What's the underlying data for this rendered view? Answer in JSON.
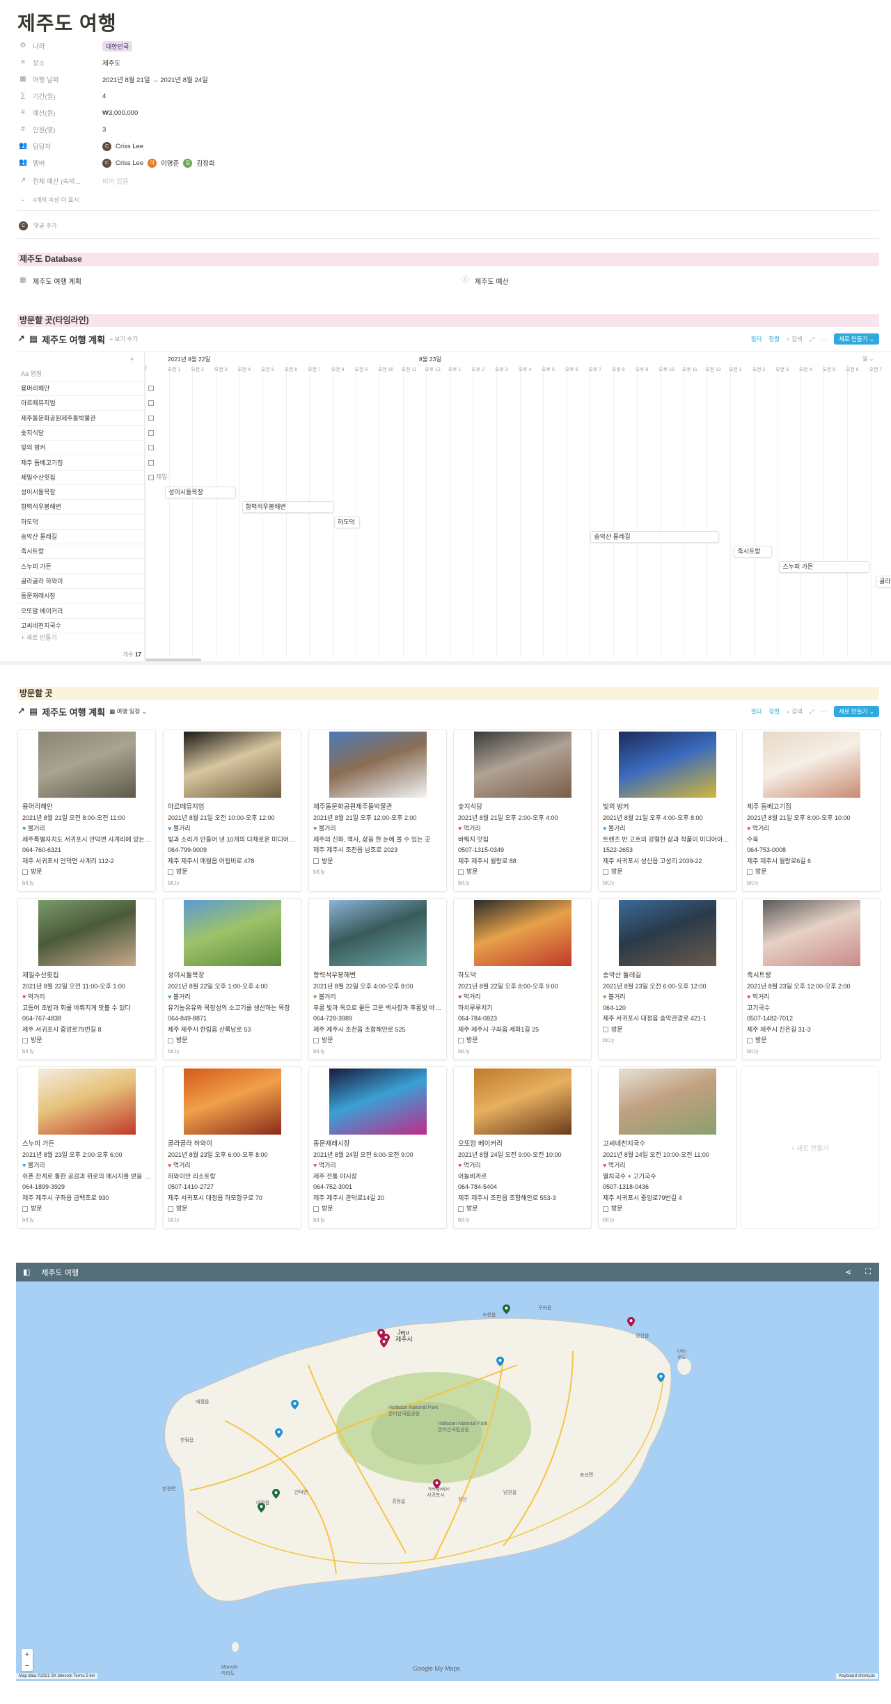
{
  "page_title": "제주도 여행",
  "properties": [
    {
      "icon": "⚙",
      "name": "나라",
      "value": "대한민국",
      "tag": true
    },
    {
      "icon": "≡",
      "name": "장소",
      "value": "제주도"
    },
    {
      "icon": "▦",
      "name": "여행 날짜",
      "value": "2021년 8월 21일 → 2021년 8월 24일"
    },
    {
      "icon": "∑",
      "name": "기간(일)",
      "value": "4"
    },
    {
      "icon": "#",
      "name": "예산(원)",
      "value": "₩3,000,000"
    },
    {
      "icon": "#",
      "name": "인원(명)",
      "value": "3"
    },
    {
      "icon": "👥",
      "name": "담당자",
      "value": "Criss Lee"
    },
    {
      "icon": "👥",
      "name": "멤버",
      "value": "Criss Lee"
    },
    {
      "icon": "↗",
      "name": "전체 예산 (숙박...",
      "value": "비어 있음"
    }
  ],
  "members": [
    {
      "name": "Criss Lee",
      "color": "#5b4d3f",
      "initial": "C"
    },
    {
      "name": "이명준",
      "color": "#e07a1f",
      "initial": "이"
    },
    {
      "name": "김정희",
      "color": "#6aa84f",
      "initial": "김"
    }
  ],
  "hidden_props": "4개의 속성 더 표시",
  "comment_add": "댓글 추가",
  "db_section": "제주도 Database",
  "db_links": [
    "제주도 여행 계획",
    "제주도 예산"
  ],
  "timeline_section": "방문할 곳(타임라인)",
  "gallery_section": "방문할 곳",
  "db_title": "제주도 여행 계획",
  "add_view": "+ 보기 추가",
  "gallery_view": "여행 일정",
  "toolbar": {
    "filter": "필터",
    "sort": "정렬",
    "search": "검색",
    "new": "새로 만들기"
  },
  "timeline": {
    "col_header": "Aa 명칭",
    "day1": "2021년 8월 22일",
    "day2": "8월 23일",
    "month_btn": "월 ⌄",
    "hours": [
      "2",
      "오전 1",
      "오전 2",
      "오전 3",
      "오전 4",
      "오전 5",
      "오전 6",
      "오전 7",
      "오전 8",
      "오전 9",
      "오전 10",
      "오전 11",
      "오후 12",
      "오후 1",
      "오후 2",
      "오후 3",
      "오후 4",
      "오후 5",
      "오후 6",
      "오후 7",
      "오후 8",
      "오후 9",
      "오후 10",
      "오후 11",
      "오전 12",
      "오전 1",
      "오전 2",
      "오전 3",
      "오전 4",
      "오전 5",
      "오전 6",
      "오전 7",
      "오전 8"
    ],
    "rows": [
      "용머리해안",
      "아르떼뮤지엄",
      "제주돌문화공원제주돌박물관",
      "숯지식당",
      "빛의 벙커",
      "제주 돔베고기집",
      "제일수산횟집",
      "성이시돌목장",
      "항력석우봉해변",
      "하도덕",
      "송악산 둘레길",
      "죽시트랑",
      "스누피 가든",
      "골라골라 하와이",
      "동문재래시장",
      "오또맘 베이커리",
      "고씨네천지국수"
    ],
    "new_row": "+ 새로 만들기",
    "count_label": "개수",
    "count": "17",
    "bars": [
      {
        "label": "제일수산횟집",
        "row": 6,
        "start": 0.5,
        "end": 1.5
      },
      {
        "label": "성이시돌목장",
        "row": 7,
        "start": 1.3,
        "end": 6
      },
      {
        "label": "항력석우봉해변",
        "row": 8,
        "start": 6.4,
        "end": 12.5
      },
      {
        "label": "하도덕",
        "row": 9,
        "start": 12.5,
        "end": 14.2
      },
      {
        "label": "송악산 둘레길",
        "row": 10,
        "start": 29.5,
        "end": 38
      },
      {
        "label": "죽시트랑",
        "row": 11,
        "start": 39,
        "end": 41.5
      },
      {
        "label": "스누피 가든",
        "row": 12,
        "start": 42,
        "end": 48
      },
      {
        "label": "골라골라 하와이",
        "row": 13,
        "start": 48.4,
        "end": 52
      }
    ]
  },
  "cards": [
    {
      "title": "용머리해안",
      "date": "2021년 8월 21일 오전 8:00-오전 11:00",
      "tagc": "#3e9fd4",
      "tag": "볼거리",
      "desc": "제주특별자치도 서귀포시 안덕면 사계리에 있는 해...",
      "phone": "064-760-6321",
      "addr": "제주 서귀포시 안덕면 사계리 112-2",
      "check": "방문",
      "link": "bit.ly",
      "img": [
        "#8a8574",
        "#5d5a4a",
        "#a9a391"
      ]
    },
    {
      "title": "아르떼뮤지엄",
      "date": "2021년 8월 21일 오전 10:00-오후 12:00",
      "tagc": "#3e9fd4",
      "tag": "볼거리",
      "desc": "빛과 소리가 만들어 낸 10개의 다채로운 미디어아트",
      "phone": "064-799-9009",
      "addr": "제주 제주시 애월읍 어림비로 478",
      "check": "방문",
      "link": "bit.ly",
      "img": [
        "#1c1a16",
        "#6e5a3c",
        "#d7c6a0"
      ]
    },
    {
      "title": "제주돌문화공원제주돌박물관",
      "date": "2021년 8월 21일 오후 12:00-오후 2:00",
      "tagc": "#6aa84f",
      "tag": "볼거리",
      "desc": "제주의 신화, 역사, 삶을 한 눈에 볼 수 있는 곳",
      "phone": "",
      "addr": "제주 제주시 조천읍 남조로 2023",
      "check": "방문",
      "link": "bit.ly",
      "img": [
        "#4b7ab8",
        "#f2f4f6",
        "#8a6e54"
      ]
    },
    {
      "title": "숯지식당",
      "date": "2021년 8월 21일 오후 2:00-오후 4:00",
      "tagc": "#d9534f",
      "tag": "먹거리",
      "desc": "바뤄지 맛집",
      "phone": "0507-1315-0349",
      "addr": "제주 제주시 월랑로 88",
      "check": "방문",
      "link": "bit.ly",
      "img": [
        "#3a3a3a",
        "#7a5c48",
        "#b0a295"
      ]
    },
    {
      "title": "빛의 벙커",
      "date": "2021년 8월 21일 오후 4:00-오후 8:00",
      "tagc": "#3e9fd4",
      "tag": "볼거리",
      "desc": "트랜츠 반 고흐의 강렬한 삶과 작품이 미디어아트로...",
      "phone": "1522-2653",
      "addr": "제주 서귀포시 성산읍 고성리 2039-22",
      "check": "방문",
      "link": "bit.ly",
      "img": [
        "#1d2b5a",
        "#d4b83a",
        "#3a6abd"
      ]
    },
    {
      "title": "제주 돔베고기집",
      "date": "2021년 8월 21일 오후 8:00-오후 10:00",
      "tagc": "#d9534f",
      "tag": "먹거리",
      "desc": "수육",
      "phone": "064-753-0008",
      "addr": "제주 제주시 월랑로6길 6",
      "check": "방문",
      "link": "bit.ly",
      "img": [
        "#e8d9c6",
        "#c98a70",
        "#f5efe6"
      ]
    },
    {
      "title": "제일수산횟집",
      "date": "2021년 8월 22일 오전 11:00-오후 1:00",
      "tagc": "#d9534f",
      "tag": "먹거리",
      "desc": "고등어 초밥과 회를 바뤄지게 맛볼 수 있다",
      "phone": "064-767-4838",
      "addr": "제주 서귀포시 중앙로79번길 8",
      "check": "방문",
      "link": "bit.ly",
      "img": [
        "#7a9b6a",
        "#c9a98c",
        "#4a5a3a"
      ]
    },
    {
      "title": "성이시돌목장",
      "date": "2021년 8월 22일 오후 1:00-오후 4:00",
      "tagc": "#3e9fd4",
      "tag": "볼거리",
      "desc": "유기농유유와 목장성의 소고기를 생산하는 목장",
      "phone": "064-849-8871",
      "addr": "제주 제주시 한림읍 산록남로 53",
      "check": "방문",
      "link": "bit.ly",
      "img": [
        "#5a9ad4",
        "#5c8a3a",
        "#9ec26a"
      ]
    },
    {
      "title": "항력석우봉해변",
      "date": "2021년 8월 22일 오후 4:00-오후 8:00",
      "tagc": "#6aa84f",
      "tag": "볼거리",
      "desc": "푸롱 빛과 옥으로 물든 고운 백사장과 푸롱빛 바다가...",
      "phone": "064-728-3989",
      "addr": "제주 제주시 조천읍 조함해안로 525",
      "check": "방문",
      "link": "bit.ly",
      "img": [
        "#8ab4d8",
        "#6aa6a6",
        "#3a5a5a"
      ]
    },
    {
      "title": "하도덕",
      "date": "2021년 8월 22일 오후 8:00-오후 9:00",
      "tagc": "#d9534f",
      "tag": "먹거리",
      "desc": "하치루루치기",
      "phone": "064-784-0823",
      "addr": "제주 제주시 구좌읍 세화1길 25",
      "check": "방문",
      "link": "bit.ly",
      "img": [
        "#2a2a2a",
        "#c0392b",
        "#e6a24a"
      ]
    },
    {
      "title": "송악산 둘레길",
      "date": "2021년 8월 23일 오전 6:00-오후 12:00",
      "tagc": "#6aa84f",
      "tag": "볼거리",
      "desc": "064-120",
      "phone": "",
      "addr": "제주 서귀포시 대정읍 송악관광로 421-1",
      "check": "방문",
      "link": "bit.ly",
      "img": [
        "#3a6a9a",
        "#6a5a4a",
        "#2a3a4a"
      ]
    },
    {
      "title": "죽시트랑",
      "date": "2021년 8월 23일 오후 12:00-오후 2:00",
      "tagc": "#d9534f",
      "tag": "먹거리",
      "desc": "고기국수",
      "phone": "0507-1482-7012",
      "addr": "제주 제주시 진은길 31-3",
      "check": "방문",
      "link": "bit.ly",
      "img": [
        "#5a5a5a",
        "#c98a8a",
        "#e6d2c6"
      ]
    },
    {
      "title": "스누피 가든",
      "date": "2021년 8월 23일 오후 2:00-오후 6:00",
      "tagc": "#3e9fd4",
      "tag": "볼거리",
      "desc": "쉬폰 잔계로 통한 공감과 위로의 메시지를 얻을 수 있...",
      "phone": "064-1899-3929",
      "addr": "제주 제주시 구좌읍 금백조로 930",
      "check": "방문",
      "link": "bit.ly",
      "img": [
        "#f3ede2",
        "#c0392b",
        "#e6c27a"
      ]
    },
    {
      "title": "골라골라 하와이",
      "date": "2021년 8월 23일 오후 6:00-오후 8:00",
      "tagc": "#d9534f",
      "tag": "먹거리",
      "desc": "하와이안 리소토랑",
      "phone": "0507-1410-2727",
      "addr": "제주 서귀포시 대정읍 하모항구로 70",
      "check": "방문",
      "link": "bit.ly",
      "img": [
        "#d45a1a",
        "#8a2a1a",
        "#f0a04a"
      ]
    },
    {
      "title": "동문재래시장",
      "date": "2021년 8월 24일 오전 6:00-오전 9:00",
      "tagc": "#d9534f",
      "tag": "먹거리",
      "desc": "제주 전통 야시장",
      "phone": "064-752-3001",
      "addr": "제주 제주시 관덕로14길 20",
      "check": "방문",
      "link": "bit.ly",
      "img": [
        "#1a1a3a",
        "#c02a8a",
        "#3aa0d4"
      ]
    },
    {
      "title": "오또맘 베이커리",
      "date": "2021년 8월 24일 오전 9:00-오전 10:00",
      "tagc": "#d9534f",
      "tag": "먹거리",
      "desc": "어놀비까르",
      "phone": "064-784-5404",
      "addr": "제주 제주시 조천읍 조함해안로 553-3",
      "check": "방문",
      "link": "bit.ly",
      "img": [
        "#c07a2a",
        "#6a3a1a",
        "#e6b060"
      ]
    },
    {
      "title": "고씨네천지국수",
      "date": "2021년 8월 24일 오전 10:00-오전 11:00",
      "tagc": "#d9534f",
      "tag": "먹거리",
      "desc": "멸치국수 + 고기국수",
      "phone": "0507-1318-0436",
      "addr": "제주 서귀포시 중앙로79번길 4",
      "check": "방문",
      "link": "bit.ly",
      "img": [
        "#e6e2d6",
        "#8aa070",
        "#c0a080"
      ]
    }
  ],
  "add_card": "+ 새로 만들기",
  "map": {
    "title": "제주도 여행",
    "labels": [
      "Jeju",
      "제주시",
      "Hallasan National Park",
      "한라산국립공원",
      "Hallasan National Park",
      "한라산국립공원",
      "Seogwipo",
      "서귀포시",
      "Udo",
      "우도",
      "Marado",
      "마라도",
      "애월읍",
      "한림읍",
      "한경면",
      "대정읍",
      "안덕면",
      "남원읍",
      "표선면",
      "성산읍",
      "구좌읍",
      "조천읍",
      "성산",
      "경정읍"
    ],
    "google": "Google My Maps",
    "footer": "Map data ©2021 SK telecom   Terms   5 km",
    "shortcuts": "Keyboard shortcuts"
  }
}
